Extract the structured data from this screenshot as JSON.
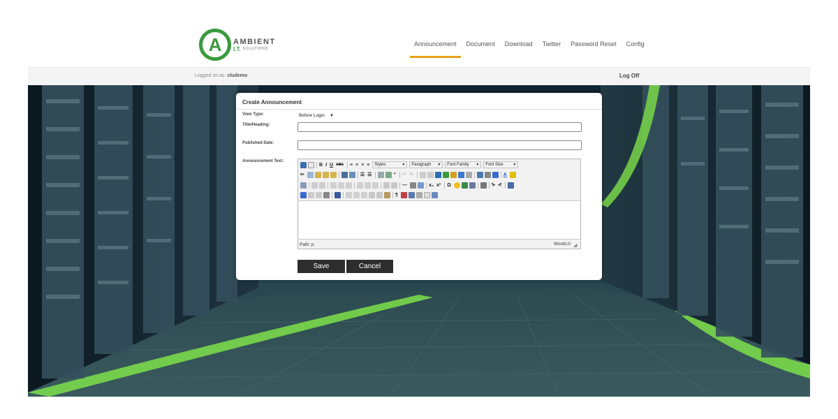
{
  "logo": {
    "letter": "A",
    "name": "AMBIENT",
    "it": "I.T.",
    "sub": "SOLUTIONS"
  },
  "nav": [
    "Announcement",
    "Document",
    "Download",
    "Twitter",
    "Password Reset",
    "Config"
  ],
  "userbar": {
    "logged_label": "Logged on as:",
    "user": "cludemo",
    "logoff": "Log Off"
  },
  "dialog": {
    "title": "Create Announcement",
    "view_type_label": "View Type:",
    "view_type_value": "Before Login",
    "title_label": "Title/Heading:",
    "published_label": "Published Date:",
    "text_label": "Announcement Text:",
    "editor": {
      "dropdowns": [
        "Styles",
        "Paragraph",
        "Font Family",
        "Font Size"
      ],
      "path": "Path: p",
      "words": "Words:0"
    },
    "save": "Save",
    "cancel": "Cancel"
  },
  "colors": {
    "brand_green": "#3a9a3e",
    "nav_accent": "#e6a11c",
    "button_dark": "#2d2d2d"
  }
}
